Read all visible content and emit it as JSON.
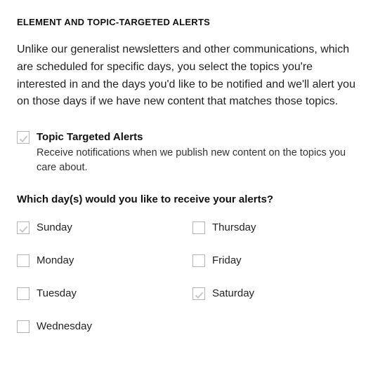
{
  "section": {
    "title": "ELEMENT AND TOPIC-TARGETED ALERTS",
    "description": "Unlike our generalist newsletters and other communications, which are scheduled for specific days, you select the topics you're interested in and the days you'd like to be notified and we'll alert you on those days if we have new content that matches those topics."
  },
  "topic_alert": {
    "checked": true,
    "label": "Topic Targeted Alerts",
    "sub": "Receive notifications when we publish new content on the topics you care about."
  },
  "days_question": "Which day(s) would you like to receive your alerts?",
  "days": {
    "col1": [
      {
        "label": "Sunday",
        "checked": true
      },
      {
        "label": "Monday",
        "checked": false
      },
      {
        "label": "Tuesday",
        "checked": false
      },
      {
        "label": "Wednesday",
        "checked": false
      }
    ],
    "col2": [
      {
        "label": "Thursday",
        "checked": false
      },
      {
        "label": "Friday",
        "checked": false
      },
      {
        "label": "Saturday",
        "checked": true
      }
    ]
  }
}
